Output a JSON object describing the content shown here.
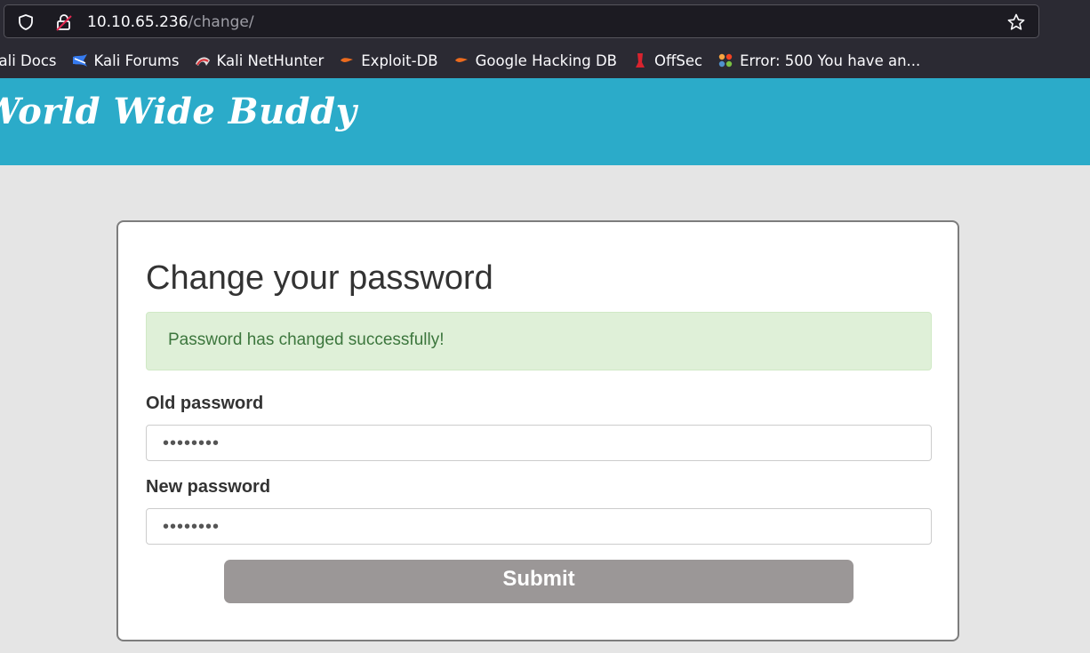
{
  "browser": {
    "url_host": "10.10.65.236",
    "url_path": "/change/",
    "bookmarks": [
      {
        "label": "Kali Docs",
        "icon": "kali-docs-icon"
      },
      {
        "label": "Kali Forums",
        "icon": "kali-forums-icon"
      },
      {
        "label": "Kali NetHunter",
        "icon": "kali-nethunter-icon"
      },
      {
        "label": "Exploit-DB",
        "icon": "exploit-db-icon"
      },
      {
        "label": "Google Hacking DB",
        "icon": "google-hacking-db-icon"
      },
      {
        "label": "OffSec",
        "icon": "offsec-icon"
      },
      {
        "label": "Error: 500 You have an...",
        "icon": "joomla-icon"
      }
    ]
  },
  "site": {
    "title": "World Wide Buddy",
    "header_color": "#2babc9"
  },
  "form": {
    "title": "Change your password",
    "alert": "Password has changed successfully!",
    "old_password_label": "Old password",
    "old_password_value": "••••••••",
    "new_password_label": "New password",
    "new_password_value": "••••••••",
    "submit_label": "Submit"
  }
}
